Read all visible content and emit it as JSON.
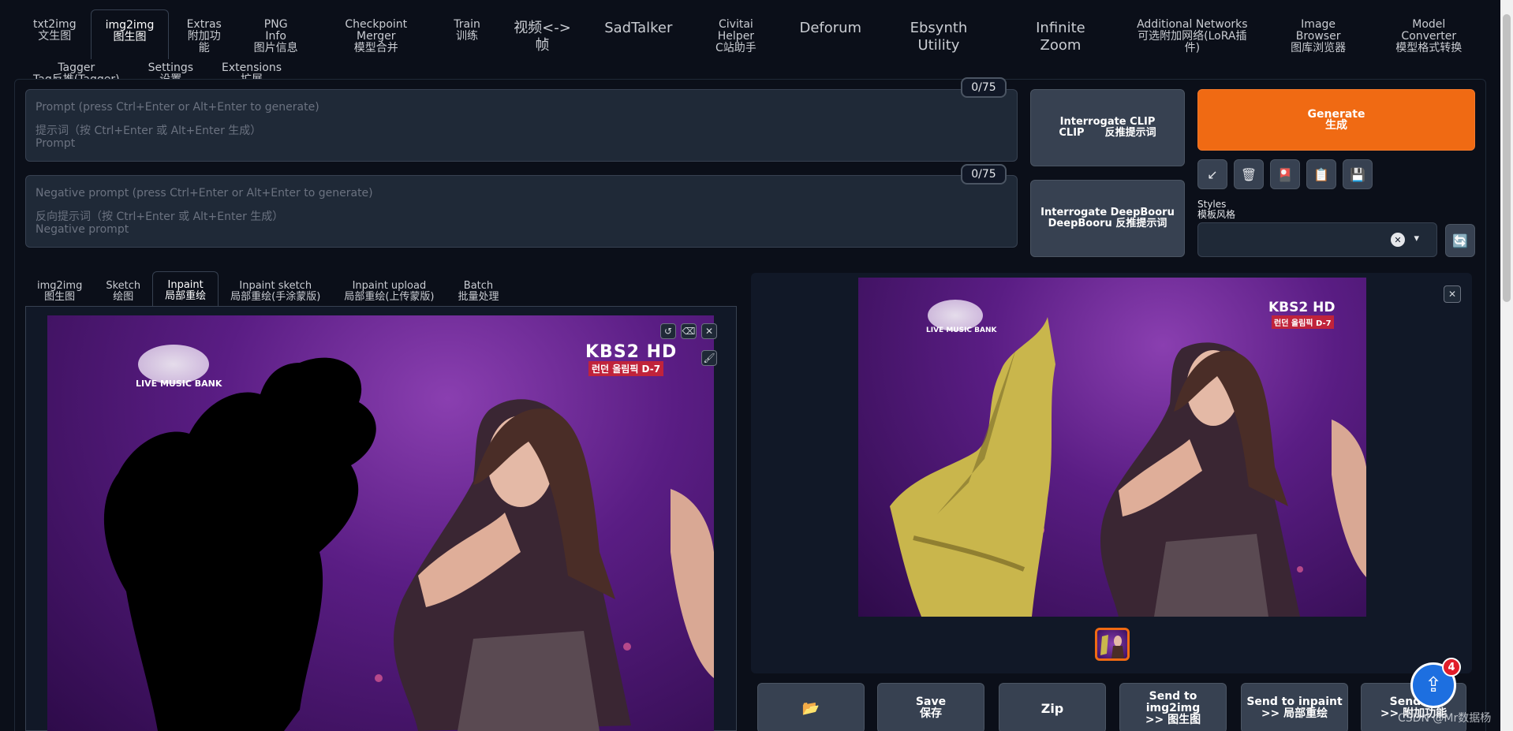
{
  "top_tabs_row1": [
    {
      "label": "txt2img\n文生图"
    },
    {
      "label": "img2img\n图生图"
    },
    {
      "label": "Extras\n附加功能"
    },
    {
      "label": "PNG Info\n图片信息"
    },
    {
      "label": "Checkpoint Merger\n模型合并"
    },
    {
      "label": "Train\n训练"
    },
    {
      "label": "视频<->帧"
    },
    {
      "label": "SadTalker"
    },
    {
      "label": "Civitai Helper\nC站助手"
    },
    {
      "label": "Deforum"
    },
    {
      "label": "Ebsynth Utility"
    },
    {
      "label": "Infinite Zoom"
    },
    {
      "label": "Additional Networks\n可选附加网络(LoRA插件)"
    },
    {
      "label": "Image Browser\n图库浏览器"
    },
    {
      "label": "Model Converter\n模型格式转换"
    }
  ],
  "top_tabs_row2": [
    {
      "label": "Tagger\nTag反推(Tagger)"
    },
    {
      "label": "Settings\n设置"
    },
    {
      "label": "Extensions\n扩展"
    }
  ],
  "prompt": {
    "placeholder_en": "Prompt (press Ctrl+Enter or Alt+Enter to generate)",
    "placeholder_cn": "提示词（按 Ctrl+Enter 或 Alt+Enter 生成）\nPrompt",
    "token_count": "0/75"
  },
  "negative_prompt": {
    "placeholder_en": "Negative prompt (press Ctrl+Enter or Alt+Enter to generate)",
    "placeholder_cn": "反向提示词（按 Ctrl+Enter 或 Alt+Enter 生成）\nNegative prompt",
    "token_count": "0/75"
  },
  "buttons": {
    "interrogate_clip": "Interrogate CLIP\nCLIP　　反推提示词",
    "interrogate_deepbooru": "Interrogate DeepBooru\nDeepBooru 反推提示词",
    "generate": "Generate\n生成"
  },
  "tool_icons": [
    {
      "name": "arrow-icon",
      "glyph": "↙"
    },
    {
      "name": "trash-icon",
      "glyph": "🗑"
    },
    {
      "name": "red-card-icon",
      "glyph": "🎴"
    },
    {
      "name": "clipboard-icon",
      "glyph": "📋"
    },
    {
      "name": "save-icon",
      "glyph": "💾"
    }
  ],
  "styles": {
    "label": "Styles\n模板风格",
    "clear_glyph": "✕",
    "dropdown_glyph": "▾",
    "refresh_glyph": "🔄"
  },
  "sub_tabs": [
    {
      "label": "img2img\n图生图"
    },
    {
      "label": "Sketch\n绘图"
    },
    {
      "label": "Inpaint\n局部重绘"
    },
    {
      "label": "Inpaint sketch\n局部重绘(手涂蒙版)"
    },
    {
      "label": "Inpaint upload\n局部重绘(上传蒙版)"
    },
    {
      "label": "Batch\n批量处理"
    }
  ],
  "input_image": {
    "logo_text": "LIVE MUSIC BANK",
    "channel_text": "KBS2 HD",
    "channel_sub": "런던 올림픽 D-7",
    "canvas_icons": [
      "↺",
      "⌫",
      "✕"
    ],
    "brush_icon": "🖌"
  },
  "output_image": {
    "logo_text": "LIVE MUSIC BANK",
    "channel_text": "KBS2 HD",
    "channel_sub": "런던 올림픽 D-7",
    "close_glyph": "✕"
  },
  "output_buttons": [
    {
      "label": "📂"
    },
    {
      "label": "Save\n保存"
    },
    {
      "label": "Zip"
    },
    {
      "label": "Send to\nimg2img\n>> 图生图"
    },
    {
      "label": "Send to inpaint\n>> 局部重绘"
    },
    {
      "label": "Send to\n>> 附加功能"
    }
  ],
  "upload_badge": {
    "count": "4",
    "glyph": "⇪"
  },
  "watermark": "CSDN @Mr数据杨"
}
